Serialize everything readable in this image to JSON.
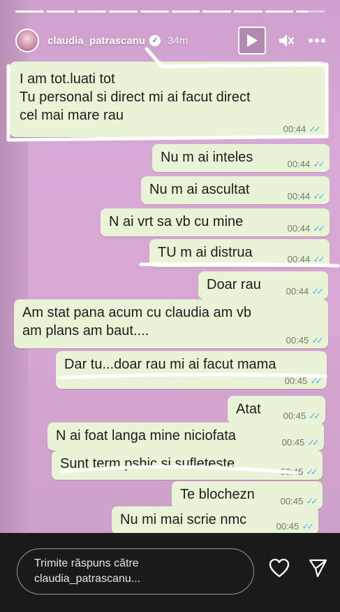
{
  "story": {
    "progress_segments": 10,
    "progress_current": 9,
    "username": "claudia_patrascanu",
    "time_ago": "34m",
    "icons": {
      "play": "play-icon",
      "mute": "mute-icon",
      "more": "more-icon",
      "verified": "verified-icon"
    }
  },
  "messages": [
    {
      "lines": [
        "I am tot.luati tot",
        "Tu personal si direct mi ai facut direct",
        "cel mai mare rau"
      ],
      "time": "00:44"
    },
    {
      "lines": [
        "Nu m ai inteles"
      ],
      "time": "00:44"
    },
    {
      "lines": [
        "Nu m ai ascultat"
      ],
      "time": "00:44"
    },
    {
      "lines": [
        "N ai vrt sa vb cu mine"
      ],
      "time": "00:44"
    },
    {
      "lines": [
        "TU m ai distrua"
      ],
      "time": "00:44"
    },
    {
      "lines": [
        "Doar rau"
      ],
      "time": "00:44"
    },
    {
      "lines": [
        "Am stat pana acum cu claudia am vb",
        "am plans am baut...."
      ],
      "time": "00:45"
    },
    {
      "lines": [
        "Dar tu...doar rau mi ai facut mama"
      ],
      "time": "00:45"
    },
    {
      "lines": [
        "Atat"
      ],
      "time": "00:45"
    },
    {
      "lines": [
        "N ai foat langa mine niciofata"
      ],
      "time": "00:45"
    },
    {
      "lines": [
        "Sunt term pshic si sufleteste"
      ],
      "time": "00:45"
    },
    {
      "lines": [
        "Te blochezn"
      ],
      "time": "00:45"
    },
    {
      "lines": [
        "Nu mi mai scrie nmc"
      ],
      "time": "00:45"
    }
  ],
  "reply": {
    "placeholder_line1": "Trimite răspuns către",
    "placeholder_line2": "claudia_patrascanu...",
    "icons": {
      "like": "heart-icon",
      "share": "send-icon"
    }
  },
  "colors": {
    "bubble": "#e9f3d6",
    "ticks": "#4fb6ec",
    "background": "#d8a6d3"
  }
}
